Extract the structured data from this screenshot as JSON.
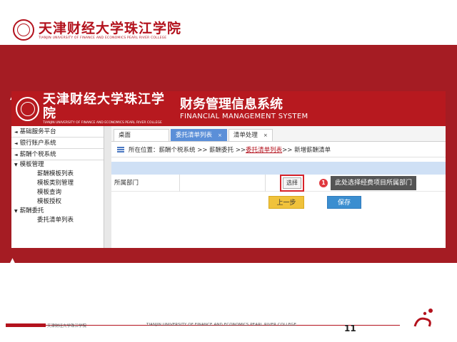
{
  "slide": {
    "logo_cn": "天津财经大学珠江学院",
    "logo_en": "TIANJIN UNIVERSITY OF FINANCE AND ECONOMICS PEARL RIVER COLLEGE",
    "bullet_1": "▲",
    "bullet_2": "▲",
    "page_number": "11",
    "footer_cn": "天津财经大学珠江学院",
    "footer_en": "TIANJIN UNIVERSITY OF FINANCE AND ECONOMICS PEARL RIVER COLLEGE",
    "colors": {
      "brand_red": "#a51c23",
      "header_red": "#b7191f",
      "tab_blue": "#5b8fd8"
    }
  },
  "app": {
    "logo_cn": "天津财经大学珠江学院",
    "logo_en": "TIANJIN UNIVERSITY OF FINANCE AND ECONOMICS PEARL RIVER COLLEGE",
    "system_title": "财务管理信息系统",
    "system_subtitle": "FINANCIAL MANAGEMENT SYSTEM",
    "sidebar": {
      "items": [
        {
          "arrow": "◄",
          "label": "基础服务平台"
        },
        {
          "arrow": "◄",
          "label": "银行账户系统"
        },
        {
          "arrow": "◄",
          "label": "薪酬个税系统"
        }
      ],
      "sub_group_label": "模板管理",
      "sub_group_arrow": "▼",
      "sub_items": [
        "薪酬模板列表",
        "模板类别管理",
        "模板查询",
        "模板授权"
      ],
      "sub_group2_label": "薪酬委托",
      "sub_group2_arrow": "▼",
      "sub_items2": [
        "委托清单列表"
      ]
    },
    "tabs": [
      {
        "label": "桌面"
      },
      {
        "label": "委托清单列表",
        "close": "×"
      },
      {
        "label": "清单处理",
        "close": "×"
      }
    ],
    "breadcrumb": {
      "prefix": "所在位置：",
      "path1": "薪酬个税系统 >> 薪酬委托 >> ",
      "link": "委托清单列表",
      "path2": " >> 新增薪酬清单"
    },
    "form": {
      "dept_label": "所属部门",
      "select_button": "选择",
      "callout_number": "1",
      "callout_text": "此处选择经费项目所属部门"
    },
    "buttons": {
      "prev": "上一步",
      "save": "保存"
    }
  }
}
